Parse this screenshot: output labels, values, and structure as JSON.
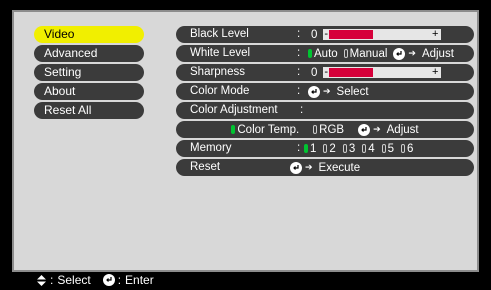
{
  "menu": {
    "items": [
      {
        "label": "Video",
        "active": true
      },
      {
        "label": "Advanced",
        "active": false
      },
      {
        "label": "Setting",
        "active": false
      },
      {
        "label": "About",
        "active": false
      },
      {
        "label": "Reset All",
        "active": false
      }
    ]
  },
  "rows": {
    "black_level": {
      "label": "Black Level",
      "colon": ":",
      "value": "0",
      "minus": "-",
      "plus": "+",
      "level_fraction": 0.45
    },
    "white_level": {
      "label": "White Level",
      "colon": ":",
      "opt_auto": "Auto",
      "opt_manual": "Manual",
      "action": "Adjust"
    },
    "sharpness": {
      "label": "Sharpness",
      "colon": ":",
      "value": "0",
      "minus": "-",
      "plus": "+",
      "level_fraction": 0.45
    },
    "color_mode": {
      "label": "Color Mode",
      "colon": ":",
      "action": "Select"
    },
    "color_adjustment": {
      "label": "Color Adjustment",
      "colon": ":"
    },
    "color_adjust_sub": {
      "opt_temp": "Color Temp.",
      "opt_rgb": "RGB",
      "action": "Adjust"
    },
    "memory": {
      "label": "Memory",
      "colon": ":",
      "slots": [
        "1",
        "2",
        "3",
        "4",
        "5",
        "6"
      ],
      "selected": "1"
    },
    "reset": {
      "label": "Reset",
      "action": "Execute"
    }
  },
  "footer": {
    "select_label": "Select",
    "enter_label": "Enter",
    "colon": ":"
  },
  "colors": {
    "active_menu": "#f1ef00",
    "slider_fill": "#d6003a",
    "radio_on": "#00c431",
    "row_bg": "#3b3b3b",
    "panel_bg": "#d8d8d8"
  }
}
